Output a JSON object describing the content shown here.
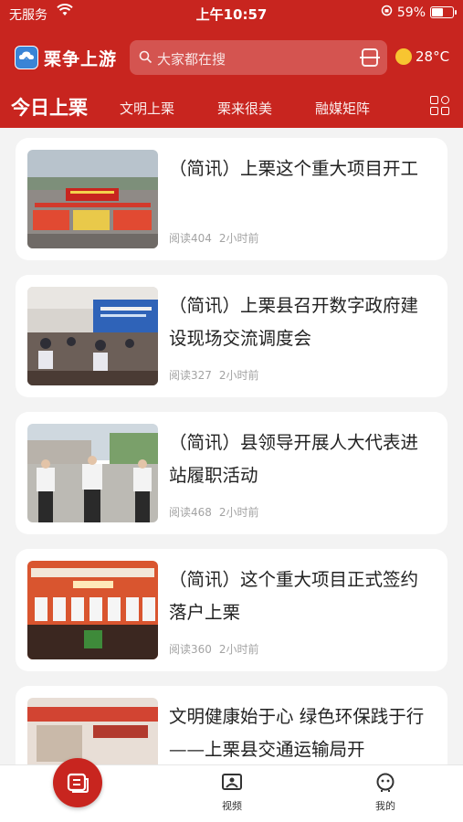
{
  "status": {
    "carrier": "无服务",
    "time": "上午10:57",
    "battery_text": "59%",
    "battery_level": 0.59
  },
  "header": {
    "app_name": "栗争上游",
    "search_placeholder": "大家都在搜",
    "weather": "28°C"
  },
  "tabs": [
    {
      "label": "今日上栗",
      "active": true
    },
    {
      "label": "文明上栗",
      "active": false
    },
    {
      "label": "栗来很美",
      "active": false
    },
    {
      "label": "融媒矩阵",
      "active": false
    }
  ],
  "articles": [
    {
      "title": "（简讯）上栗这个重大项目开工",
      "reads": "阅读404",
      "time": "2小时前"
    },
    {
      "title": "（简讯）上栗县召开数字政府建设现场交流调度会",
      "reads": "阅读327",
      "time": "2小时前"
    },
    {
      "title": "（简讯）县领导开展人大代表进站履职活动",
      "reads": "阅读468",
      "time": "2小时前"
    },
    {
      "title": "（简讯）这个重大项目正式签约落户上栗",
      "reads": "阅读360",
      "time": "2小时前"
    },
    {
      "title": "文明健康始于心 绿色环保践于行 ——上栗县交通运输局开",
      "reads": "",
      "time": ""
    }
  ],
  "bottom_nav": {
    "video": "视频",
    "mine": "我的"
  },
  "colors": {
    "brand_red": "#c8251f",
    "background": "#f3f3f3"
  }
}
